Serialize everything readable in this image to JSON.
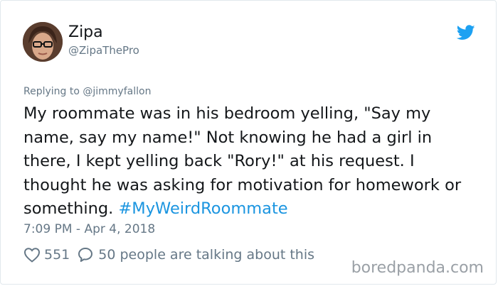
{
  "tweet": {
    "display_name": "Zipa",
    "handle": "@ZipaThePro",
    "reply_to": "Replying to @jimmyfallon",
    "text": "My roommate was in his bedroom yelling, \"Say my name, say my name!\" Not knowing he had a girl in there, I kept yelling back \"Rory!\" at his request. I thought he was asking for motivation for homework or something.",
    "hashtag": "#MyWeirdRoommate",
    "timestamp": "7:09 PM - Apr 4, 2018",
    "likes": "551",
    "talking": "50 people are talking about this"
  },
  "watermark": "boredpanda.com",
  "icons": {
    "brand": "twitter-bird-icon",
    "like": "heart-icon",
    "reply": "speech-bubble-icon"
  },
  "colors": {
    "link": "#1b95e0",
    "secondary_text": "#657786",
    "primary_text": "#14171a",
    "brand": "#1da1f2"
  }
}
